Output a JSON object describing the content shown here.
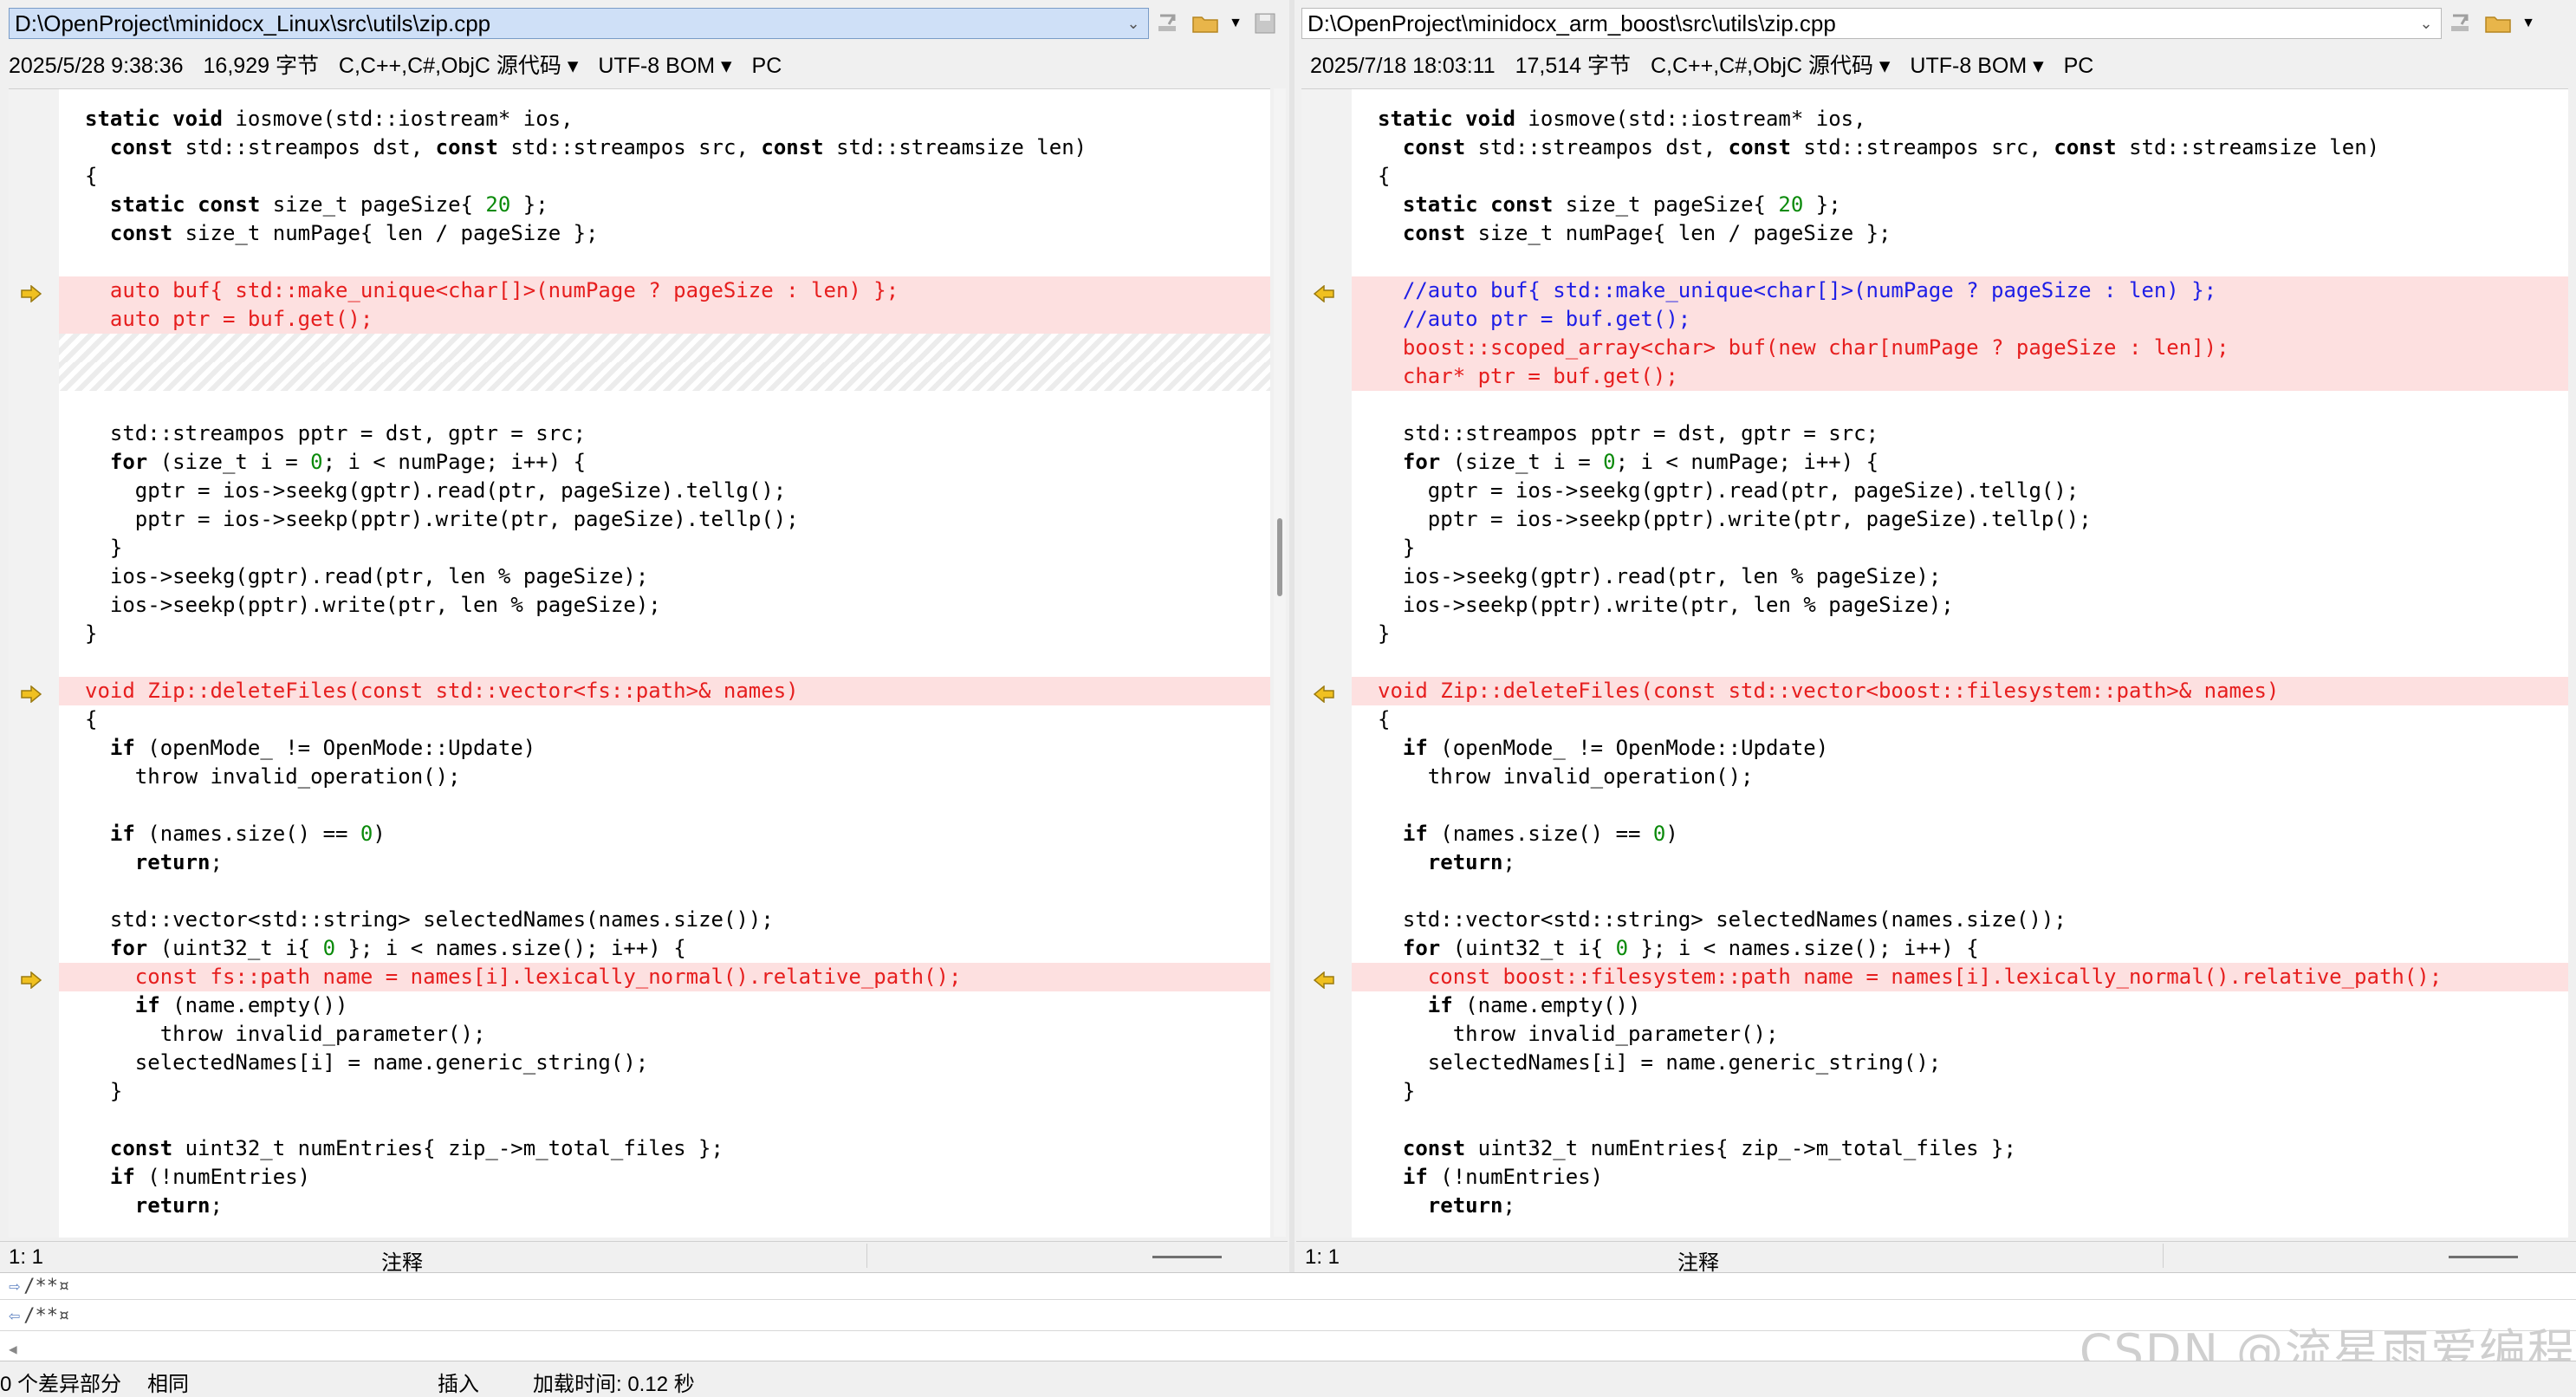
{
  "left": {
    "path": "D:\\OpenProject\\minidocx_Linux\\src\\utils\\zip.cpp",
    "timestamp": "2025/5/28 9:38:36",
    "size": "16,929 字节",
    "language": "C,C++,C#,ObjC 源代码",
    "encoding": "UTF-8 BOM",
    "line_ending": "PC",
    "cursor_pos": "1: 1",
    "status_mode": "注释",
    "lines": [
      {
        "t": "static void iosmove(std::iostream* ios,",
        "k": 1
      },
      {
        "t": "  const std::streampos dst, const std::streampos src, const std::streamsize len)",
        "k": 1
      },
      {
        "t": "{"
      },
      {
        "t": "  static const size_t pageSize{ 20 };",
        "k": 1
      },
      {
        "t": "  const size_t numPage{ len / pageSize };",
        "k": 1
      },
      {
        "t": ""
      },
      {
        "t": "  auto buf{ std::make_unique<char[]>(numPage ? pageSize : len) };",
        "d": "diff",
        "a": 1
      },
      {
        "t": "  auto ptr = buf.get();",
        "d": "diff"
      },
      {
        "t": "",
        "d": "hatch"
      },
      {
        "t": "",
        "d": "hatch"
      },
      {
        "t": ""
      },
      {
        "t": "  std::streampos pptr = dst, gptr = src;"
      },
      {
        "t": "  for (size_t i = 0; i < numPage; i++) {",
        "k": 1
      },
      {
        "t": "    gptr = ios->seekg(gptr).read(ptr, pageSize).tellg();"
      },
      {
        "t": "    pptr = ios->seekp(pptr).write(ptr, pageSize).tellp();"
      },
      {
        "t": "  }"
      },
      {
        "t": "  ios->seekg(gptr).read(ptr, len % pageSize);"
      },
      {
        "t": "  ios->seekp(pptr).write(ptr, len % pageSize);"
      },
      {
        "t": "}"
      },
      {
        "t": ""
      },
      {
        "t": "void Zip::deleteFiles(const std::vector<fs::path>& names)",
        "d": "diff",
        "a": 1
      },
      {
        "t": "{"
      },
      {
        "t": "  if (openMode_ != OpenMode::Update)",
        "k": 1
      },
      {
        "t": "    throw invalid_operation();"
      },
      {
        "t": ""
      },
      {
        "t": "  if (names.size() == 0)",
        "k": 1
      },
      {
        "t": "    return;",
        "k": 1
      },
      {
        "t": ""
      },
      {
        "t": "  std::vector<std::string> selectedNames(names.size());"
      },
      {
        "t": "  for (uint32_t i{ 0 }; i < names.size(); i++) {",
        "k": 1
      },
      {
        "t": "    const fs::path name = names[i].lexically_normal().relative_path();",
        "d": "diff",
        "a": 1
      },
      {
        "t": "    if (name.empty())",
        "k": 1
      },
      {
        "t": "      throw invalid_parameter();"
      },
      {
        "t": "    selectedNames[i] = name.generic_string();"
      },
      {
        "t": "  }"
      },
      {
        "t": ""
      },
      {
        "t": "  const uint32_t numEntries{ zip_->m_total_files };",
        "k": 1
      },
      {
        "t": "  if (!numEntries)",
        "k": 1
      },
      {
        "t": "    return;",
        "k": 1
      }
    ]
  },
  "right": {
    "path": "D:\\OpenProject\\minidocx_arm_boost\\src\\utils\\zip.cpp",
    "timestamp": "2025/7/18 18:03:11",
    "size": "17,514 字节",
    "language": "C,C++,C#,ObjC 源代码",
    "encoding": "UTF-8 BOM",
    "line_ending": "PC",
    "cursor_pos": "1: 1",
    "status_mode": "注释",
    "lines": [
      {
        "t": "static void iosmove(std::iostream* ios,",
        "k": 1
      },
      {
        "t": "  const std::streampos dst, const std::streampos src, const std::streamsize len)",
        "k": 1
      },
      {
        "t": "{"
      },
      {
        "t": "  static const size_t pageSize{ 20 };",
        "k": 1
      },
      {
        "t": "  const size_t numPage{ len / pageSize };",
        "k": 1
      },
      {
        "t": ""
      },
      {
        "t": "  //auto buf{ std::make_unique<char[]>(numPage ? pageSize : len) };",
        "d": "diff cmt",
        "a": 1
      },
      {
        "t": "  //auto ptr = buf.get();",
        "d": "diff cmt"
      },
      {
        "t": "  boost::scoped_array<char> buf(new char[numPage ? pageSize : len]);",
        "d": "diff"
      },
      {
        "t": "  char* ptr = buf.get();",
        "d": "diff"
      },
      {
        "t": ""
      },
      {
        "t": "  std::streampos pptr = dst, gptr = src;"
      },
      {
        "t": "  for (size_t i = 0; i < numPage; i++) {",
        "k": 1
      },
      {
        "t": "    gptr = ios->seekg(gptr).read(ptr, pageSize).tellg();"
      },
      {
        "t": "    pptr = ios->seekp(pptr).write(ptr, pageSize).tellp();"
      },
      {
        "t": "  }"
      },
      {
        "t": "  ios->seekg(gptr).read(ptr, len % pageSize);"
      },
      {
        "t": "  ios->seekp(pptr).write(ptr, len % pageSize);"
      },
      {
        "t": "}"
      },
      {
        "t": ""
      },
      {
        "t": "void Zip::deleteFiles(const std::vector<boost::filesystem::path>& names)",
        "d": "diff",
        "a": 1
      },
      {
        "t": "{"
      },
      {
        "t": "  if (openMode_ != OpenMode::Update)",
        "k": 1
      },
      {
        "t": "    throw invalid_operation();"
      },
      {
        "t": ""
      },
      {
        "t": "  if (names.size() == 0)",
        "k": 1
      },
      {
        "t": "    return;",
        "k": 1
      },
      {
        "t": ""
      },
      {
        "t": "  std::vector<std::string> selectedNames(names.size());"
      },
      {
        "t": "  for (uint32_t i{ 0 }; i < names.size(); i++) {",
        "k": 1
      },
      {
        "t": "    const boost::filesystem::path name = names[i].lexically_normal().relative_path();",
        "d": "diff",
        "a": 1
      },
      {
        "t": "    if (name.empty())",
        "k": 1
      },
      {
        "t": "      throw invalid_parameter();"
      },
      {
        "t": "    selectedNames[i] = name.generic_string();"
      },
      {
        "t": "  }"
      },
      {
        "t": ""
      },
      {
        "t": "  const uint32_t numEntries{ zip_->m_total_files };",
        "k": 1
      },
      {
        "t": "  if (!numEntries)",
        "k": 1
      },
      {
        "t": "    return;",
        "k": 1
      }
    ]
  },
  "bottom": {
    "line1": "/**¤",
    "line2": "/**¤"
  },
  "status": {
    "diff_count": "0 个差异部分",
    "same": "相同",
    "insert": "插入",
    "load_time": "加载时间:  0.12 秒"
  },
  "watermark": "CSDN @流星雨爱编程",
  "colors": {
    "diff_bg": "#fde0e0",
    "diff_text": "#e61e1e",
    "comment_text": "#1e1ee6",
    "path_bg_active": "#cfe0f7",
    "arrow": "#f0c020"
  }
}
